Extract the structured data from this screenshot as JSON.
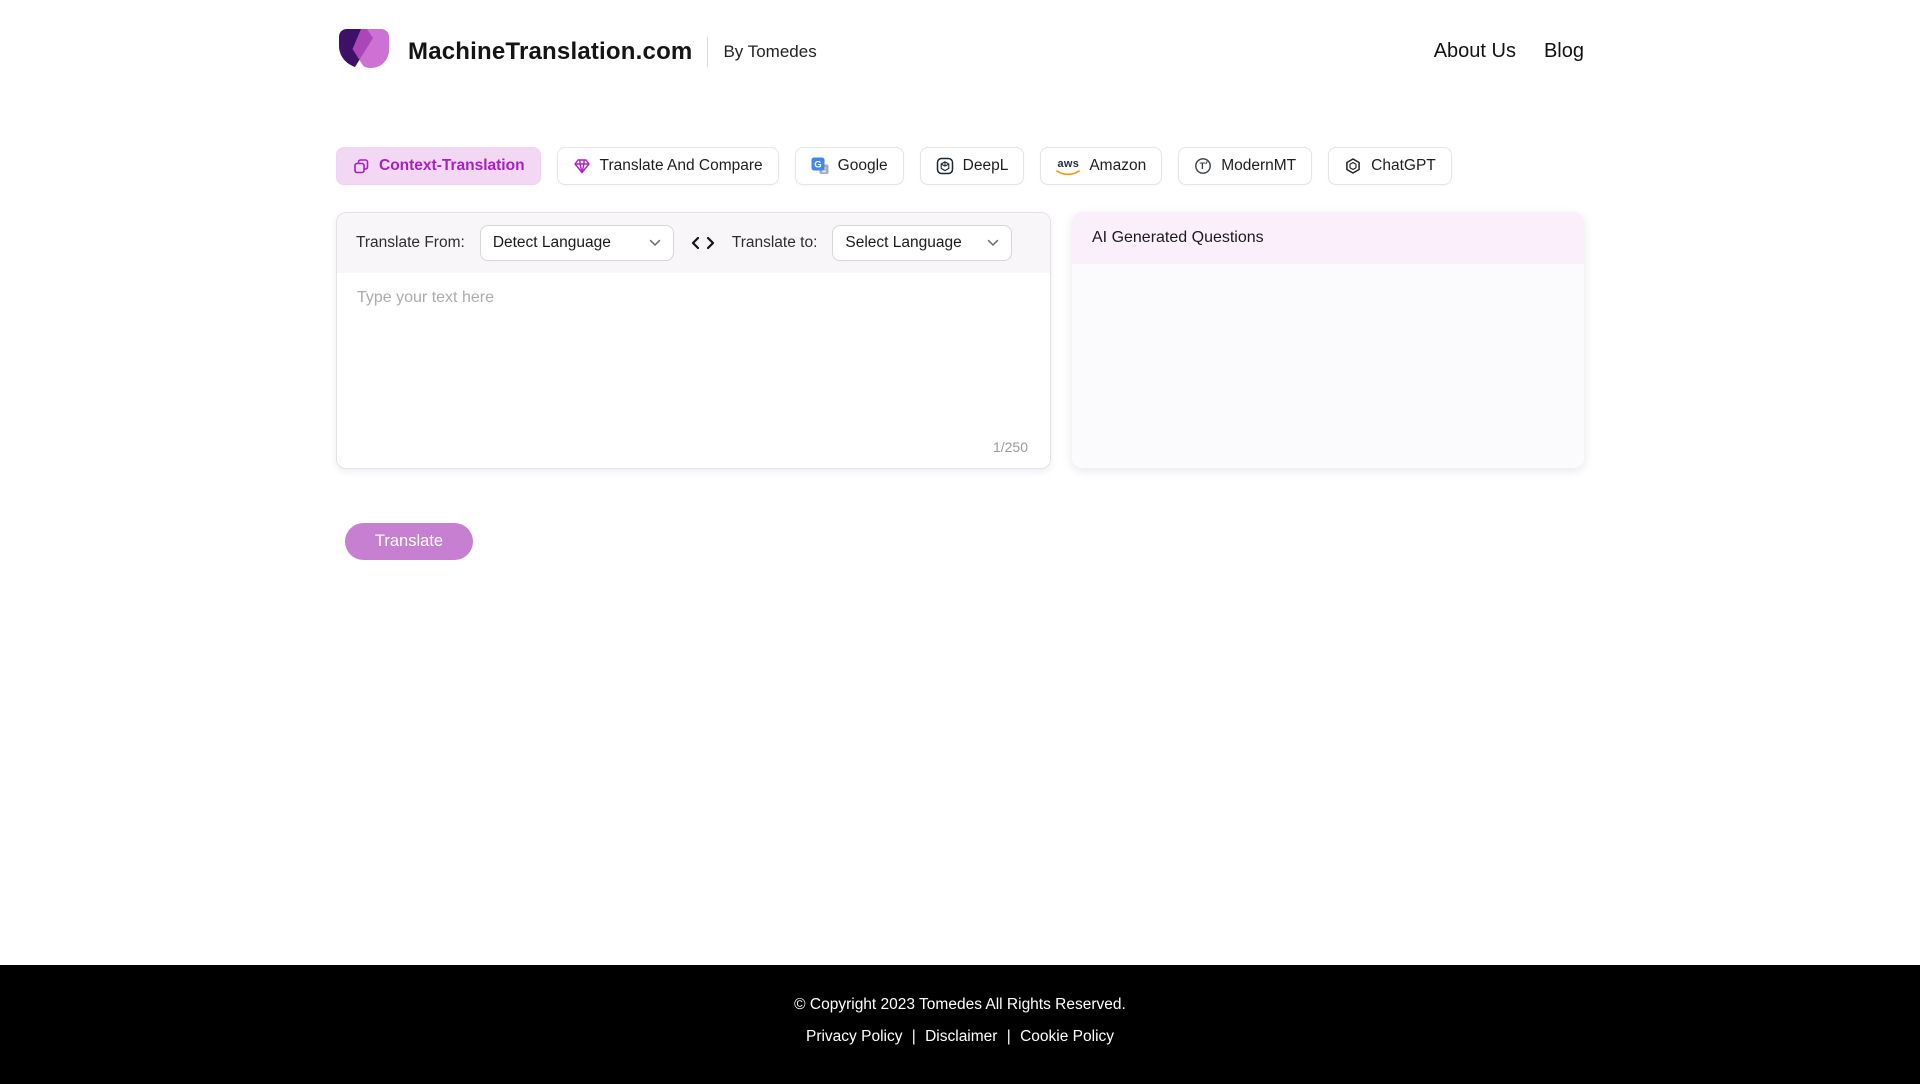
{
  "header": {
    "brand_title": "MachineTranslation.com",
    "brand_subtitle": "By Tomedes",
    "nav": [
      {
        "label": "About Us"
      },
      {
        "label": "Blog"
      }
    ]
  },
  "tabs": [
    {
      "label": "Context-Translation",
      "icon": "copy-icon",
      "active": true
    },
    {
      "label": "Translate And Compare",
      "icon": "gem-icon",
      "active": false
    },
    {
      "label": "Google",
      "icon": "google-translate-icon",
      "active": false
    },
    {
      "label": "DeepL",
      "icon": "deepl-icon",
      "active": false
    },
    {
      "label": "Amazon",
      "icon": "aws-icon",
      "active": false
    },
    {
      "label": "ModernMT",
      "icon": "modernmt-icon",
      "active": false
    },
    {
      "label": "ChatGPT",
      "icon": "chatgpt-icon",
      "active": false
    }
  ],
  "icon_glyphs": {
    "aws": "aws",
    "modernmt": "T",
    "google": "G"
  },
  "translator": {
    "from_label": "Translate From:",
    "from_value": "Detect Language",
    "to_label": "Translate to:",
    "to_value": "Select Language",
    "input_placeholder": "Type your text here",
    "char_counter": "1/250",
    "button_label": "Translate"
  },
  "ai_panel": {
    "title": "AI Generated Questions"
  },
  "footer": {
    "copyright": "© Copyright 2023 Tomedes All Rights Reserved.",
    "links": [
      "Privacy Policy",
      "Disclaimer",
      "Cookie Policy"
    ],
    "separator": "|"
  },
  "colors": {
    "accent_purple": "#a81fc4",
    "active_tab_bg": "#f3d8f4",
    "translate_button_bg": "#c77fd1",
    "ai_header_bg": "#fceffc",
    "panel_body_bg": "#fbfafd",
    "footer_bg": "#000000",
    "logo_dark_purple": "#3d1168",
    "logo_magenta": "#c352cb",
    "aws_swoosh_orange": "#f79400",
    "google_blue": "#4286f5"
  }
}
